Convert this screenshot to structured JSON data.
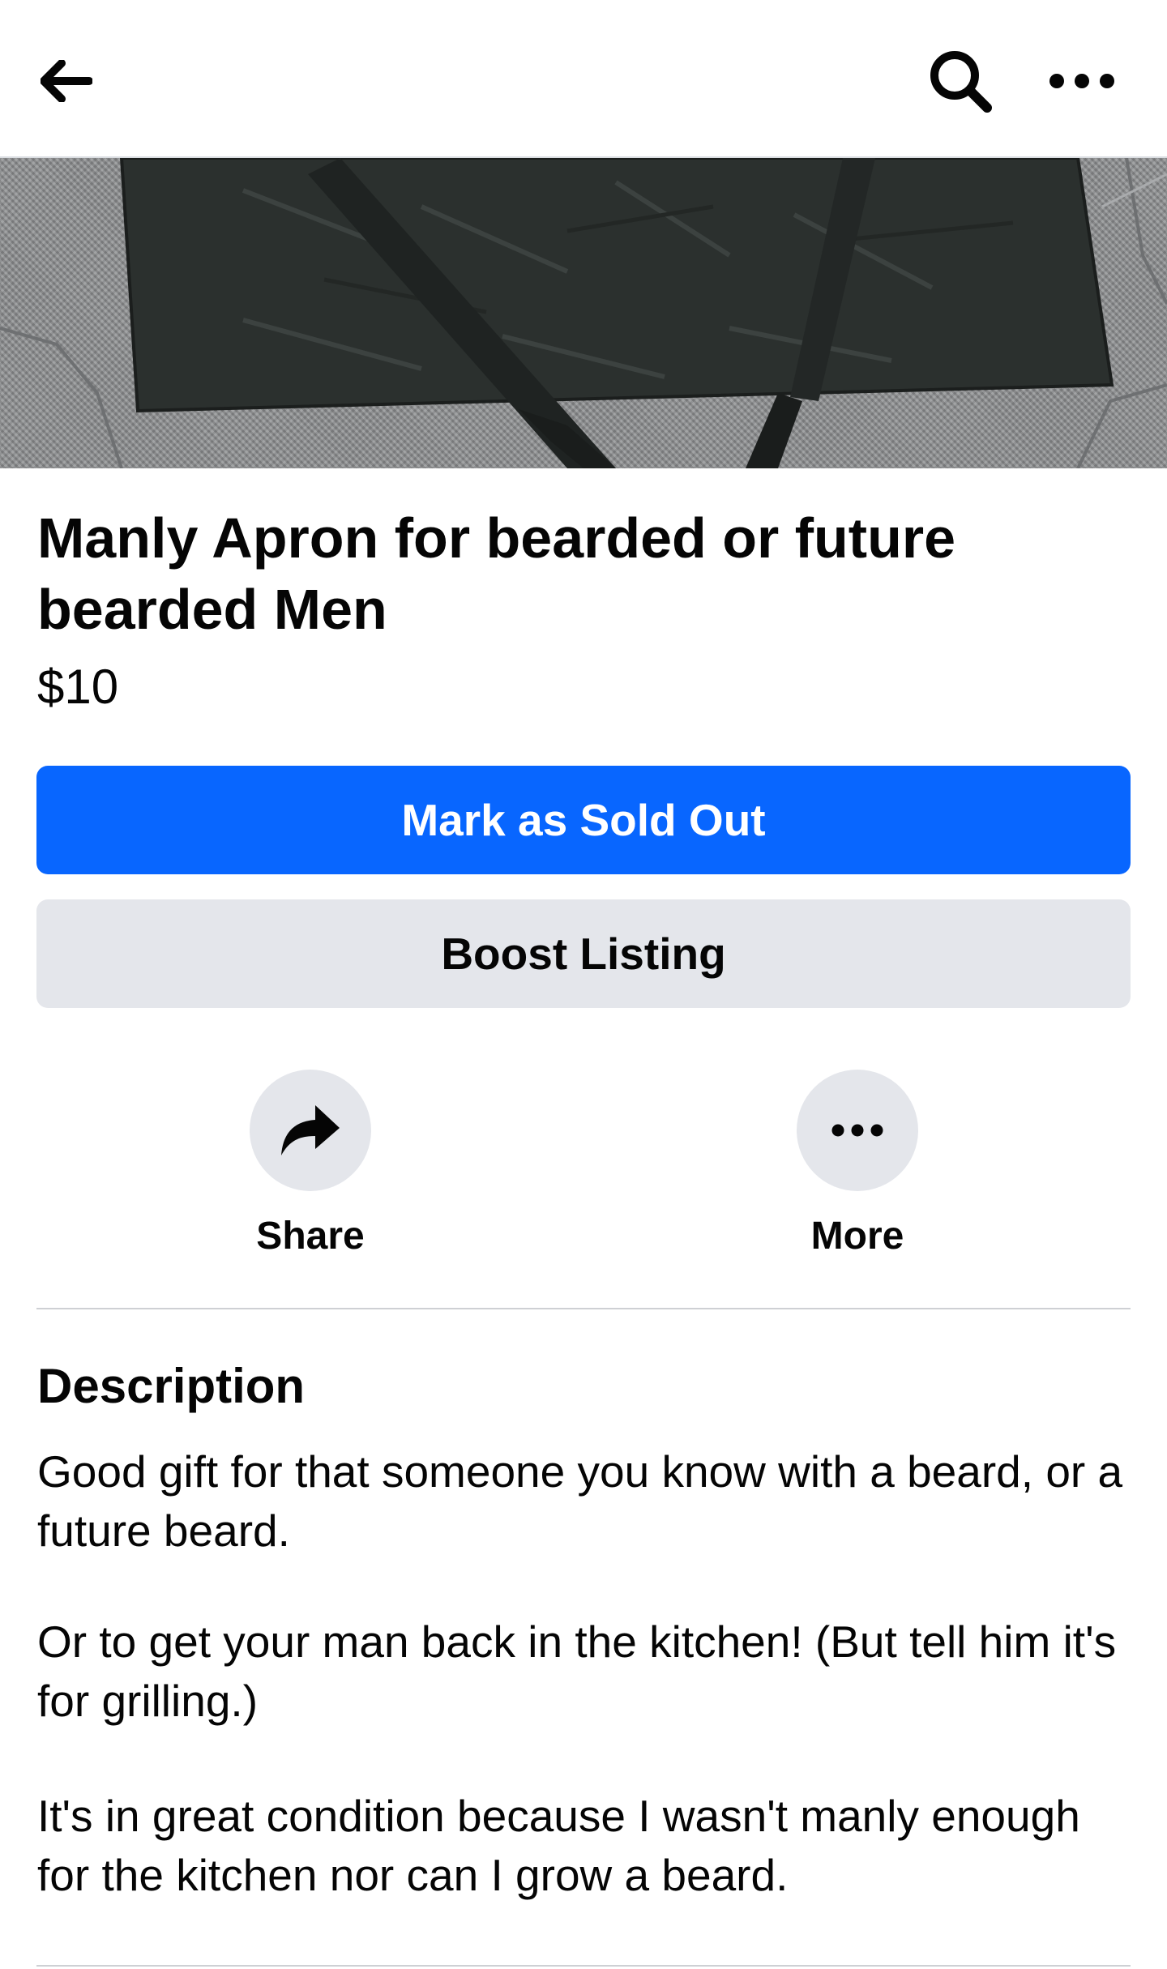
{
  "header": {
    "back_icon": "arrow-left-icon",
    "search_icon": "search-icon",
    "menu_icon": "more-horizontal-icon"
  },
  "listing": {
    "title": "Manly Apron for bearded or future bearded Men",
    "price": "$10"
  },
  "buttons": {
    "mark_sold": "Mark as Sold Out",
    "boost": "Boost Listing"
  },
  "actions": {
    "share": {
      "label": "Share",
      "icon": "share-arrow-icon"
    },
    "more": {
      "label": "More",
      "icon": "more-horizontal-icon"
    }
  },
  "description": {
    "heading": "Description",
    "paragraphs": [
      "Good gift for that someone you know with a beard, or a future beard.",
      "Or to get your man back in the kitchen! (But tell him it's for grilling.)",
      "It's in great condition because I wasn't manly enough for the kitchen nor can I grow a beard."
    ]
  },
  "colors": {
    "primary": "#0866ff",
    "secondary": "#e4e6eb",
    "text": "#050505",
    "divider": "#ced0d4"
  }
}
